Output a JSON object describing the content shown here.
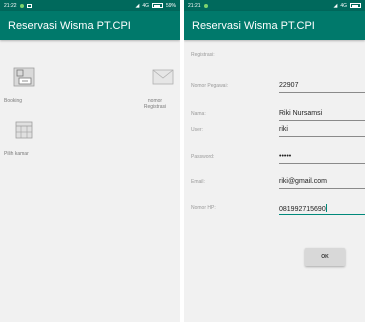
{
  "left_screen": {
    "status": {
      "time": "21:22",
      "network": "4G",
      "battery": "59%"
    },
    "app_title": "Reservasi Wisma PT.CPI",
    "menu": [
      {
        "label": "Booking",
        "icon": "booking-icon"
      },
      {
        "label": "nomor\nRegistrasi",
        "icon": "envelope-icon"
      },
      {
        "label": "Pilih kamar",
        "icon": "calendar-icon"
      }
    ]
  },
  "right_screen": {
    "status": {
      "time": "21:21",
      "network": "4G"
    },
    "app_title": "Reservasi Wisma PT.CPI",
    "form_title": "Registrasi:",
    "fields": [
      {
        "label": "Nomor Pegawai:",
        "value": "22907"
      },
      {
        "label": "Nama:",
        "value": "Riki Nursamsi"
      },
      {
        "label": "User:",
        "value": "riki"
      },
      {
        "label": "Password:",
        "value": "•••••"
      },
      {
        "label": "Email:",
        "value": "riki@gmail.com"
      },
      {
        "label": "Nomor HP:",
        "value": "081992715690"
      }
    ],
    "ok_label": "OK"
  },
  "colors": {
    "primary": "#00796b",
    "primary_dark": "#00695c",
    "accent": "#00897b"
  }
}
